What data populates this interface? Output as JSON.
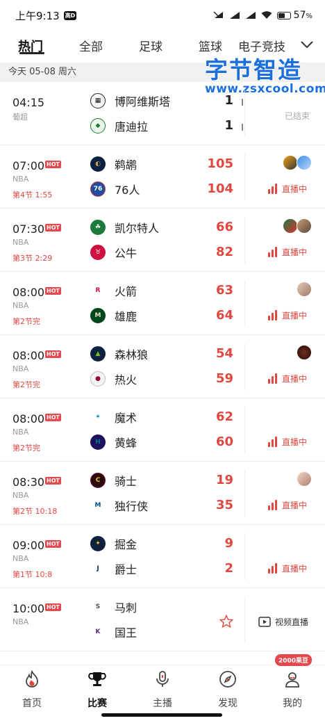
{
  "status_bar": {
    "time": "上午9:13",
    "hd": "高D",
    "battery": "57",
    "battery_unit": "%",
    "battery_level": 0.57
  },
  "tabs": [
    {
      "label": "热门",
      "active": true
    },
    {
      "label": "全部"
    },
    {
      "label": "足球"
    },
    {
      "label": "篮球"
    },
    {
      "label": "电子竞技"
    }
  ],
  "watermark": {
    "title": "字节智造",
    "url": "www.zsxcool.com"
  },
  "date_bar": "今天 05-08 周六",
  "colors": {
    "accent": "#e2473f",
    "hot": "#e5484d",
    "muted": "#999999"
  },
  "matches": [
    {
      "time": "04:15",
      "hot": "",
      "league": "葡超",
      "status": "",
      "team1": {
        "name": "博阿维斯塔",
        "score": "1",
        "logo": "boavista-logo"
      },
      "team2": {
        "name": "唐迪拉",
        "score": "1",
        "logo": "tondela-logo"
      },
      "right": "已结束"
    },
    {
      "time": "07:00",
      "hot": "HOT",
      "league": "NBA",
      "status": "第4节 1:55",
      "team1": {
        "name": "鹈鹕",
        "score": "105",
        "logo": "pelicans-logo"
      },
      "team2": {
        "name": "76人",
        "score": "104",
        "logo": "76ers-logo"
      },
      "right": "直播中"
    },
    {
      "time": "07:30",
      "hot": "HOT",
      "league": "NBA",
      "status": "第3节 2:29",
      "team1": {
        "name": "凯尔特人",
        "score": "66",
        "logo": "celtics-logo"
      },
      "team2": {
        "name": "公牛",
        "score": "82",
        "logo": "bulls-logo"
      },
      "right": "直播中"
    },
    {
      "time": "08:00",
      "hot": "HOT",
      "league": "NBA",
      "status": "第2节完",
      "team1": {
        "name": "火箭",
        "score": "63",
        "logo": "rockets-logo"
      },
      "team2": {
        "name": "雄鹿",
        "score": "64",
        "logo": "bucks-logo"
      },
      "right": "直播中"
    },
    {
      "time": "08:00",
      "hot": "HOT",
      "league": "NBA",
      "status": "第2节完",
      "team1": {
        "name": "森林狼",
        "score": "54",
        "logo": "timberwolves-logo"
      },
      "team2": {
        "name": "热火",
        "score": "59",
        "logo": "heat-logo"
      },
      "right": "直播中"
    },
    {
      "time": "08:00",
      "hot": "HOT",
      "league": "NBA",
      "status": "第2节完",
      "team1": {
        "name": "魔术",
        "score": "62",
        "logo": "magic-logo"
      },
      "team2": {
        "name": "黄蜂",
        "score": "60",
        "logo": "hornets-logo"
      },
      "right": "直播中"
    },
    {
      "time": "08:30",
      "hot": "HOT",
      "league": "NBA",
      "status": "第2节 10:18",
      "team1": {
        "name": "骑士",
        "score": "19",
        "logo": "cavaliers-logo"
      },
      "team2": {
        "name": "独行侠",
        "score": "35",
        "logo": "mavericks-logo"
      },
      "right": "直播中"
    },
    {
      "time": "09:00",
      "hot": "HOT",
      "league": "NBA",
      "status": "第1节 10:8",
      "team1": {
        "name": "掘金",
        "score": "9",
        "logo": "nuggets-logo"
      },
      "team2": {
        "name": "爵士",
        "score": "2",
        "logo": "jazz-logo"
      },
      "right": "直播中"
    },
    {
      "time": "10:00",
      "hot": "HOT",
      "league": "NBA",
      "status": "",
      "team1": {
        "name": "马刺",
        "score": "",
        "logo": "spurs-logo"
      },
      "team2": {
        "name": "国王",
        "score": "",
        "logo": "kings-logo"
      },
      "right": "视频直播"
    }
  ],
  "bottom_nav": {
    "items": [
      {
        "label": "首页",
        "icon": "flame-icon"
      },
      {
        "label": "比赛",
        "icon": "trophy-icon",
        "active": true
      },
      {
        "label": "主播",
        "icon": "microphone-icon"
      },
      {
        "label": "发现",
        "icon": "compass-icon"
      },
      {
        "label": "我的",
        "icon": "profile-icon"
      }
    ],
    "badge": "2000果豆"
  }
}
